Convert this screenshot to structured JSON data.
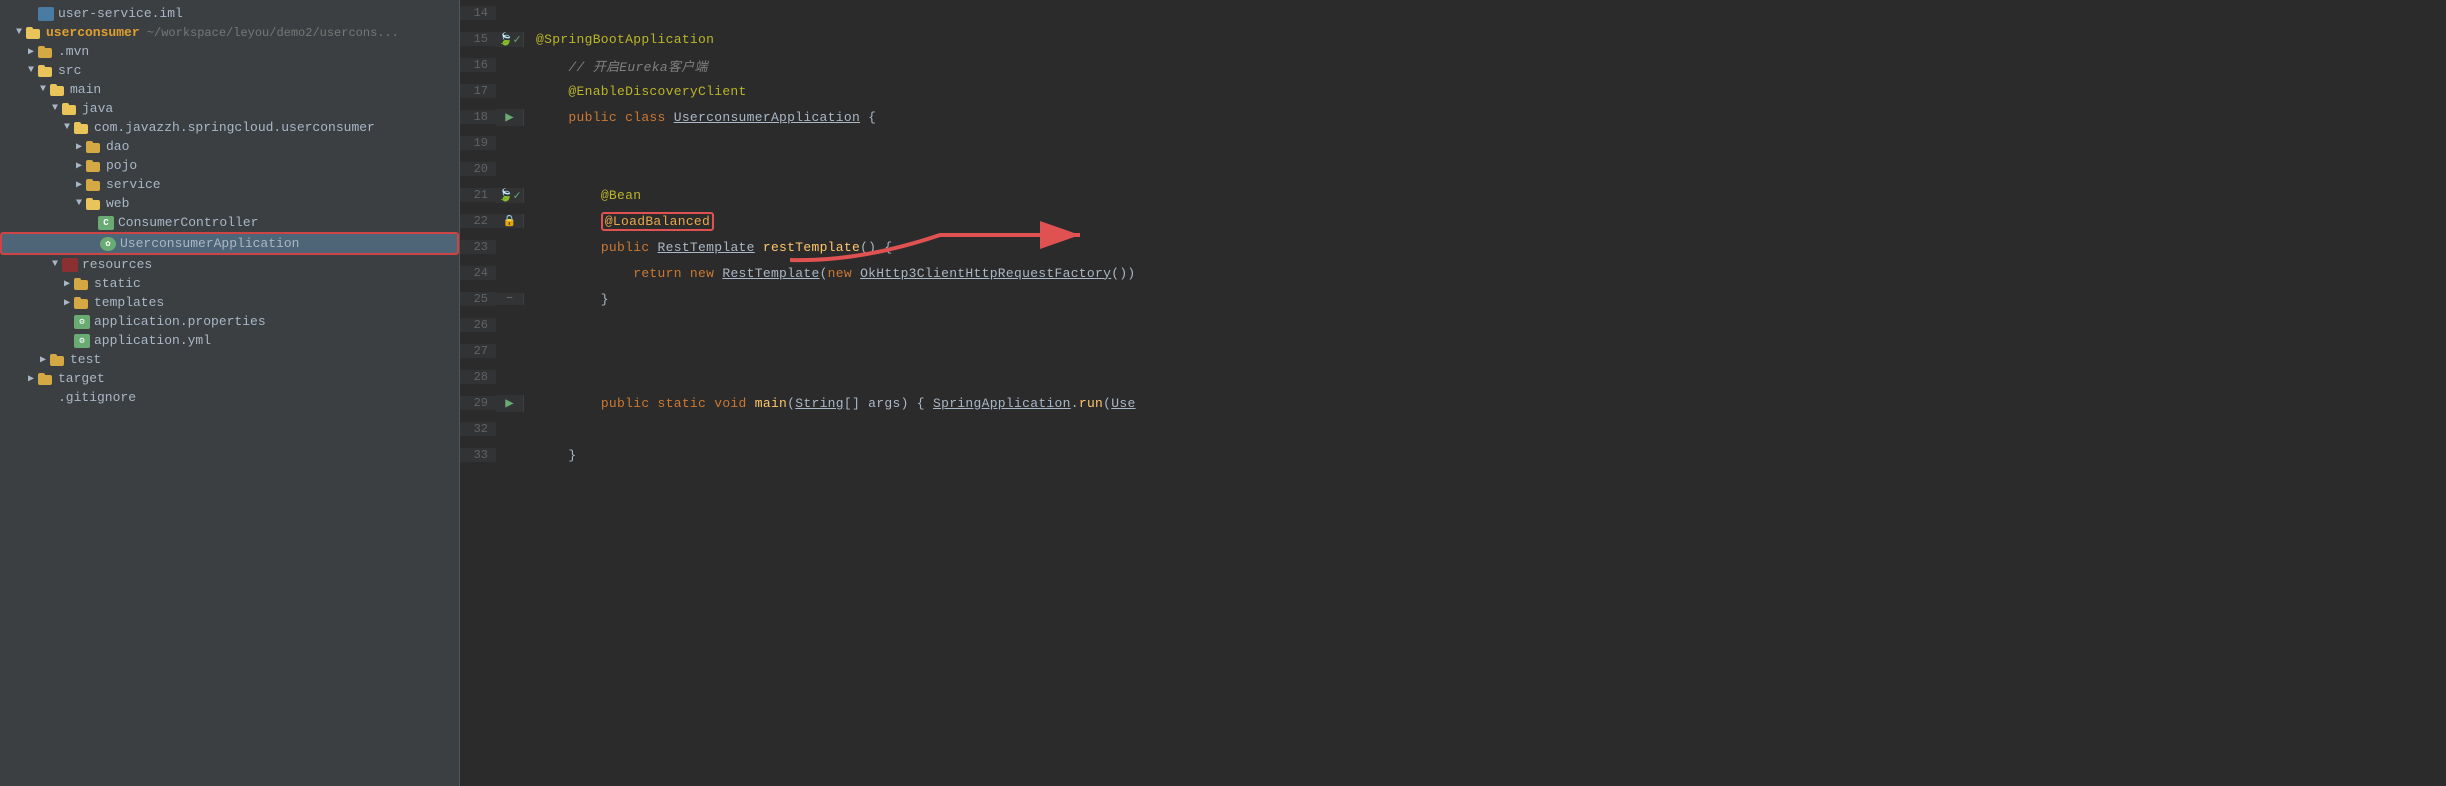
{
  "sidebar": {
    "items": [
      {
        "id": "user-service-iml",
        "label": "user-service.iml",
        "indent": "indent2",
        "type": "iml",
        "arrow": "empty"
      },
      {
        "id": "userconsumer",
        "label": "userconsumer",
        "path": "~/workspace/leyou/demo2/usercons...",
        "indent": "indent1",
        "type": "module",
        "arrow": "open"
      },
      {
        "id": "mvn",
        "label": ".mvn",
        "indent": "indent2",
        "type": "folder",
        "arrow": "closed"
      },
      {
        "id": "src",
        "label": "src",
        "indent": "indent2",
        "type": "folder",
        "arrow": "open"
      },
      {
        "id": "main",
        "label": "main",
        "indent": "indent3",
        "type": "folder",
        "arrow": "open"
      },
      {
        "id": "java",
        "label": "java",
        "indent": "indent4",
        "type": "folder",
        "arrow": "open"
      },
      {
        "id": "com-pkg",
        "label": "com.javazzh.springcloud.userconsumer",
        "indent": "indent5",
        "type": "folder",
        "arrow": "open"
      },
      {
        "id": "dao",
        "label": "dao",
        "indent": "indent6",
        "type": "folder",
        "arrow": "closed"
      },
      {
        "id": "pojo",
        "label": "pojo",
        "indent": "indent6",
        "type": "folder",
        "arrow": "closed"
      },
      {
        "id": "service",
        "label": "service",
        "indent": "indent6",
        "type": "folder",
        "arrow": "closed"
      },
      {
        "id": "web",
        "label": "web",
        "indent": "indent6",
        "type": "folder",
        "arrow": "open"
      },
      {
        "id": "ConsumerController",
        "label": "ConsumerController",
        "indent": "indent7",
        "type": "java",
        "arrow": "empty"
      },
      {
        "id": "UserconsumerApplication",
        "label": "UserconsumerApplication",
        "indent": "indent7",
        "type": "spring",
        "arrow": "empty",
        "selected": true,
        "highlighted": true
      },
      {
        "id": "resources",
        "label": "resources",
        "indent": "indent4",
        "type": "folder-res",
        "arrow": "open"
      },
      {
        "id": "static",
        "label": "static",
        "indent": "indent5",
        "type": "folder",
        "arrow": "closed"
      },
      {
        "id": "templates",
        "label": "templates",
        "indent": "indent5",
        "type": "folder",
        "arrow": "closed"
      },
      {
        "id": "application-properties",
        "label": "application.properties",
        "indent": "indent5",
        "type": "properties",
        "arrow": "empty"
      },
      {
        "id": "application-yml",
        "label": "application.yml",
        "indent": "indent5",
        "type": "properties",
        "arrow": "empty"
      },
      {
        "id": "test",
        "label": "test",
        "indent": "indent3",
        "type": "folder",
        "arrow": "closed"
      },
      {
        "id": "target",
        "label": "target",
        "indent": "indent2",
        "type": "folder",
        "arrow": "closed"
      },
      {
        "id": "gitignore",
        "label": ".gitignore",
        "indent": "indent2",
        "type": "file",
        "arrow": "empty"
      }
    ]
  },
  "code": {
    "lines": [
      {
        "num": 14,
        "gutter": "",
        "content": ""
      },
      {
        "num": 15,
        "gutter": "bean+check",
        "content": "@SpringBootApplication"
      },
      {
        "num": 16,
        "gutter": "",
        "content": "    // 开启Eureka客户端"
      },
      {
        "num": 17,
        "gutter": "",
        "content": "    @EnableDiscoveryClient"
      },
      {
        "num": 18,
        "gutter": "run",
        "content": "    public class UserconsumerApplication {"
      },
      {
        "num": 19,
        "gutter": "",
        "content": ""
      },
      {
        "num": 20,
        "gutter": "",
        "content": ""
      },
      {
        "num": 21,
        "gutter": "bean+check",
        "content": "        @Bean"
      },
      {
        "num": 22,
        "gutter": "lock",
        "content": "        @LoadBalanced"
      },
      {
        "num": 23,
        "gutter": "",
        "content": "        public RestTemplate restTemplate() {"
      },
      {
        "num": 24,
        "gutter": "",
        "content": "            return new RestTemplate(new OkHttp3ClientHttpRequestFactory())"
      },
      {
        "num": 25,
        "gutter": "fold",
        "content": "        }"
      },
      {
        "num": 26,
        "gutter": "",
        "content": ""
      },
      {
        "num": 27,
        "gutter": "",
        "content": ""
      },
      {
        "num": 28,
        "gutter": "",
        "content": ""
      },
      {
        "num": 29,
        "gutter": "run",
        "content": "        public static void main(String[] args) { SpringApplication.run(Use"
      },
      {
        "num": 32,
        "gutter": "",
        "content": ""
      },
      {
        "num": 33,
        "gutter": "",
        "content": "    }"
      }
    ]
  },
  "arrow": {
    "label": "points to @LoadBalanced annotation"
  }
}
